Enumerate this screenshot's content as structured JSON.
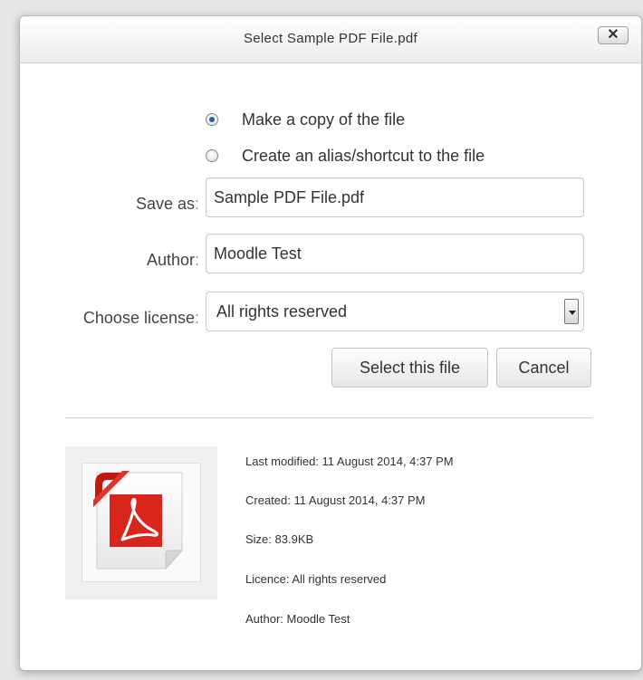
{
  "dialog": {
    "title": "Select Sample PDF File.pdf",
    "close_label": "✕"
  },
  "options": {
    "copy_label": "Make a copy of the file",
    "alias_label": "Create an alias/shortcut to the file",
    "selected": "copy"
  },
  "fields": {
    "save_as_label": "Save as",
    "save_as_value": "Sample PDF File.pdf",
    "author_label": "Author",
    "author_value": "Moodle Test",
    "license_label": "Choose license",
    "license_value": "All rights reserved",
    "colon": ":"
  },
  "buttons": {
    "select_label": "Select this file",
    "cancel_label": "Cancel"
  },
  "file_info": {
    "last_modified": "Last modified: 11 August 2014, 4:37 PM",
    "created": "Created: 11 August 2014, 4:37 PM",
    "size": "Size: 83.9KB",
    "licence": "Licence: All rights reserved",
    "author": "Author: Moodle Test"
  },
  "icons": {
    "file_thumbnail": "pdf-file-icon",
    "pdf_red": "#d9261c"
  }
}
